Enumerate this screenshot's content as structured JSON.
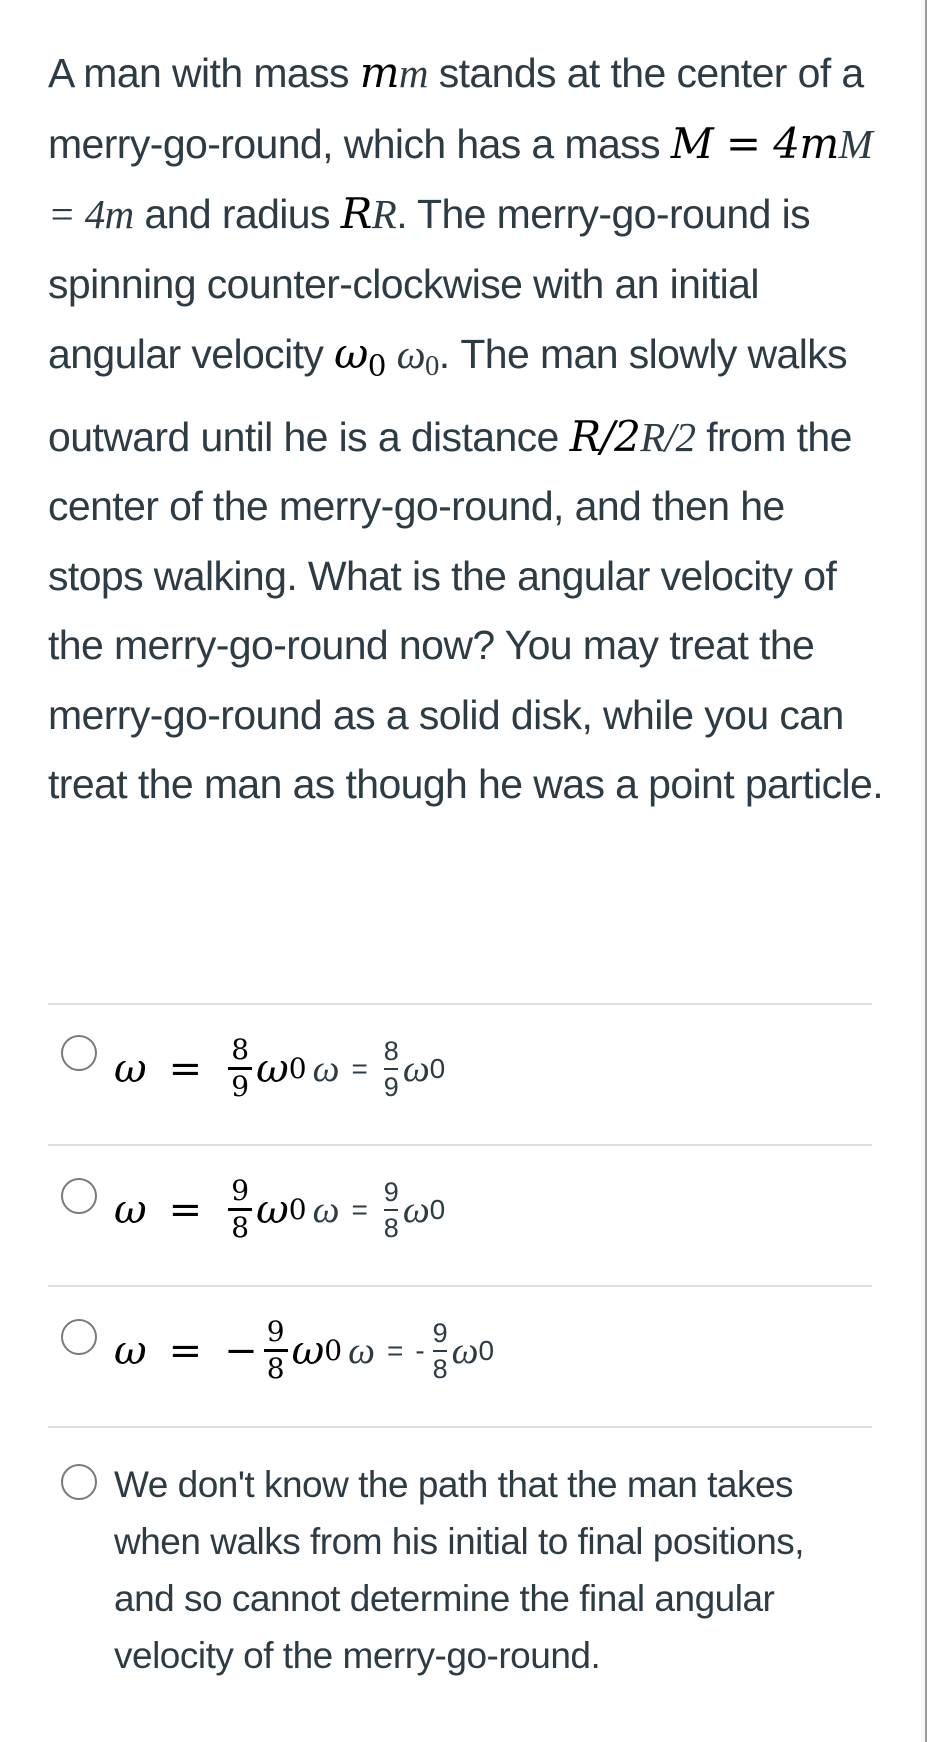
{
  "question": {
    "segments": {
      "s1": "A man with mass ",
      "m_var": "m",
      "m_var_alt": "m",
      "s2": " stands at the center of a merry-go-round, which has a mass ",
      "M_eq": "M = 4m",
      "M_eq_alt": "M = 4m",
      "s3": " and radius ",
      "R_var": "R",
      "R_var_alt": "R",
      "s4": ". The merry-go-round is spinning counter-clockwise with an initial angular velocity ",
      "omega0": "ω",
      "omega0_sub": "0",
      "omega0_alt": "ω",
      "omega0_alt_sub": "0",
      "s5": ". The man slowly walks outward until he is a distance ",
      "dist": "R/2",
      "dist_alt": "R/2",
      "s6": " from the center of the merry-go-round, and then he stops walking. What is the angular velocity of the merry-go-round now? You may treat the merry-go-round as a solid disk, while you can treat the man as though he was a point particle."
    }
  },
  "answers": [
    {
      "omega": "ω",
      "equals": "=",
      "sign": "",
      "numerator": "8",
      "denominator": "9",
      "omega0": "ω",
      "sub": "0",
      "selected": false
    },
    {
      "omega": "ω",
      "equals": "=",
      "sign": "",
      "numerator": "9",
      "denominator": "8",
      "omega0": "ω",
      "sub": "0",
      "selected": false
    },
    {
      "omega": "ω",
      "equals": "=",
      "sign": "−",
      "sign_alt": "-",
      "numerator": "9",
      "denominator": "8",
      "omega0": "ω",
      "sub": "0",
      "selected": false
    },
    {
      "text": "We don't know the path that the man takes when walks from his initial to final positions, and so cannot determine the final angular velocity of the merry-go-round.",
      "selected": false
    }
  ],
  "colors": {
    "text": "#2d3b45",
    "math": "#000000",
    "divider": "#dedede",
    "radio_border": "#7a7a7a"
  }
}
